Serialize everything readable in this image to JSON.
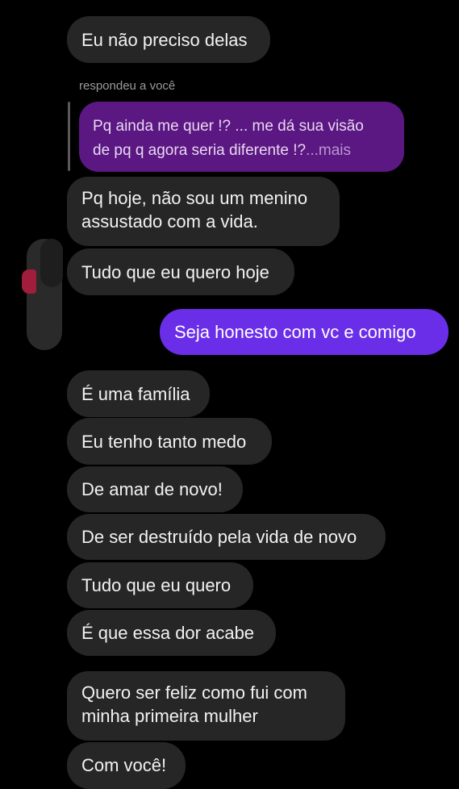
{
  "messages": [
    {
      "id": "m1",
      "text": "Eu não preciso delas"
    },
    {
      "id": "m2",
      "text": "Pq hoje, não sou um menino",
      "text2": "assustado com a vida."
    },
    {
      "id": "m3",
      "text": "Tudo que eu quero hoje"
    },
    {
      "id": "m4",
      "text": "Seja honesto com vc e comigo"
    },
    {
      "id": "m5",
      "text": "É uma família"
    },
    {
      "id": "m6",
      "text": "Eu tenho tanto medo"
    },
    {
      "id": "m7",
      "text": "De amar de novo!"
    },
    {
      "id": "m8",
      "text": "De ser destruído pela vida de novo"
    },
    {
      "id": "m9",
      "text": "Tudo que eu quero"
    },
    {
      "id": "m10",
      "text": "É que essa dor acabe"
    },
    {
      "id": "m11",
      "text": "Quero ser feliz como fui com",
      "text2": "minha primeira mulher"
    },
    {
      "id": "m12",
      "text": "Com você!"
    }
  ],
  "reply": {
    "label": "respondeu a você",
    "quoted_line1": "Pq ainda me quer !? ... me dá sua visão",
    "quoted_line2": "de pq q agora seria diferente !?",
    "more": "...mais"
  },
  "colors": {
    "background": "#000000",
    "received_bubble": "#262626",
    "sent_bubble": "#6a2ee8",
    "quoted_bubble": "#5b1782",
    "text": "#f2f2f2"
  }
}
